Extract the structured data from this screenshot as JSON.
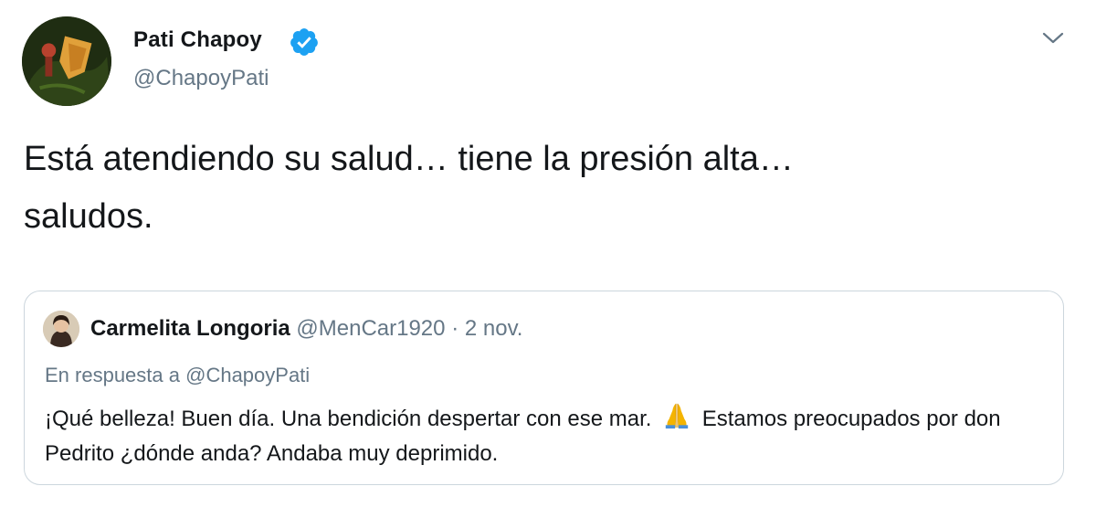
{
  "author": {
    "display_name": "Pati Chapoy",
    "handle": "@ChapoyPati",
    "verified": true,
    "verified_icon": "verified-badge-icon"
  },
  "menu": {
    "icon": "chevron-down-icon"
  },
  "tweet": {
    "text": "Está atendiendo su salud… tiene la presión alta…\nsaludos."
  },
  "quoted_tweet": {
    "display_name": "Carmelita Longoria",
    "handle": "@MenCar1920",
    "separator": "·",
    "date": "2 nov.",
    "reply_prefix": "En respuesta a ",
    "reply_to": "@ChapoyPati",
    "text_before_emoji": "¡Qué belleza! Buen día. Una bendición despertar con ese mar.",
    "emoji_icon": "folded-hands-icon",
    "text_after_emoji": "Estamos preocupados por don Pedrito ¿dónde anda? Andaba muy deprimido."
  },
  "colors": {
    "text_primary": "#14171a",
    "text_secondary": "#657786",
    "verified_blue": "#1da1f2",
    "border": "#ccd6dd"
  }
}
